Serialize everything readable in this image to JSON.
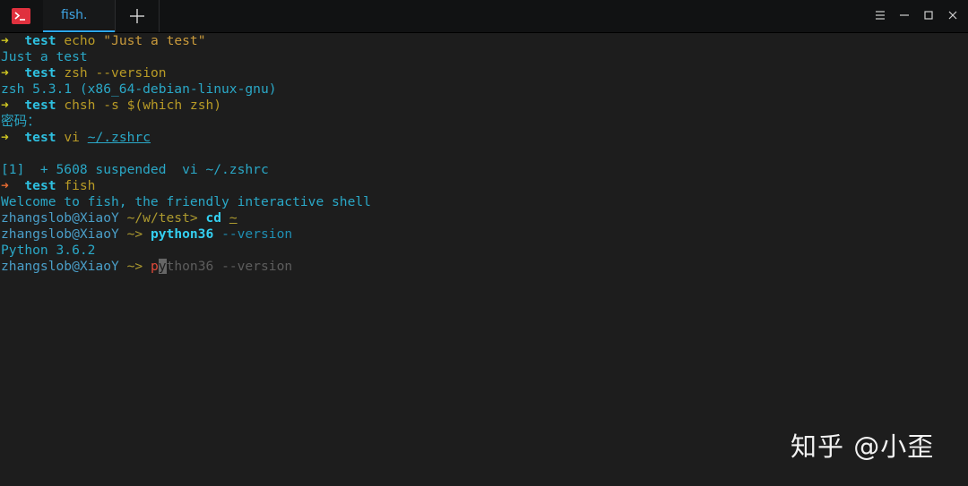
{
  "tab": {
    "label": "fish."
  },
  "terminal": {
    "lines": [
      {
        "arrow": "➜",
        "dir": "test",
        "cmd": "echo",
        "args": "\"Just a test\""
      },
      {
        "output": "Just a test"
      },
      {
        "arrow": "➜",
        "dir": "test",
        "cmd": "zsh",
        "args": "--version"
      },
      {
        "output": "zsh 5.3.1 (x86_64-debian-linux-gnu)"
      },
      {
        "arrow": "➜",
        "dir": "test",
        "cmd": "chsh",
        "args": "-s $(which zsh)"
      },
      {
        "output": "密码："
      },
      {
        "arrow": "➜",
        "dir": "test",
        "cmd": "vi",
        "args": "~/.zshrc"
      },
      {
        "output": "[1]  + 5608 suspended  vi ~/.zshrc"
      },
      {
        "arrow": "➜",
        "dir": "test",
        "cmd": "fish"
      },
      {
        "output": "Welcome to fish, the friendly interactive shell"
      },
      {
        "user": "zhangslob@XiaoY",
        "path": "~/w/test>",
        "cmd": "cd",
        "args": "~"
      },
      {
        "user": "zhangslob@XiaoY",
        "path": "~>",
        "cmd": "python36",
        "args": "--version"
      },
      {
        "output": "Python 3.6.2"
      },
      {
        "user": "zhangslob@XiaoY",
        "path": "~>",
        "typed": "p",
        "cursor_char": "y",
        "suggestion": "thon36 --version"
      }
    ]
  },
  "watermark": "知乎 @小歪",
  "colors": {
    "background": "#1d1d1d",
    "titlebar": "#111213",
    "accent": "#2ca7f8",
    "app_icon": "#e0313e"
  },
  "icons": {
    "app": "terminal-icon",
    "new_tab": "plus-icon",
    "menu": "hamburger-menu-icon",
    "minimize": "minimize-icon",
    "maximize": "maximize-icon",
    "close": "close-icon"
  }
}
